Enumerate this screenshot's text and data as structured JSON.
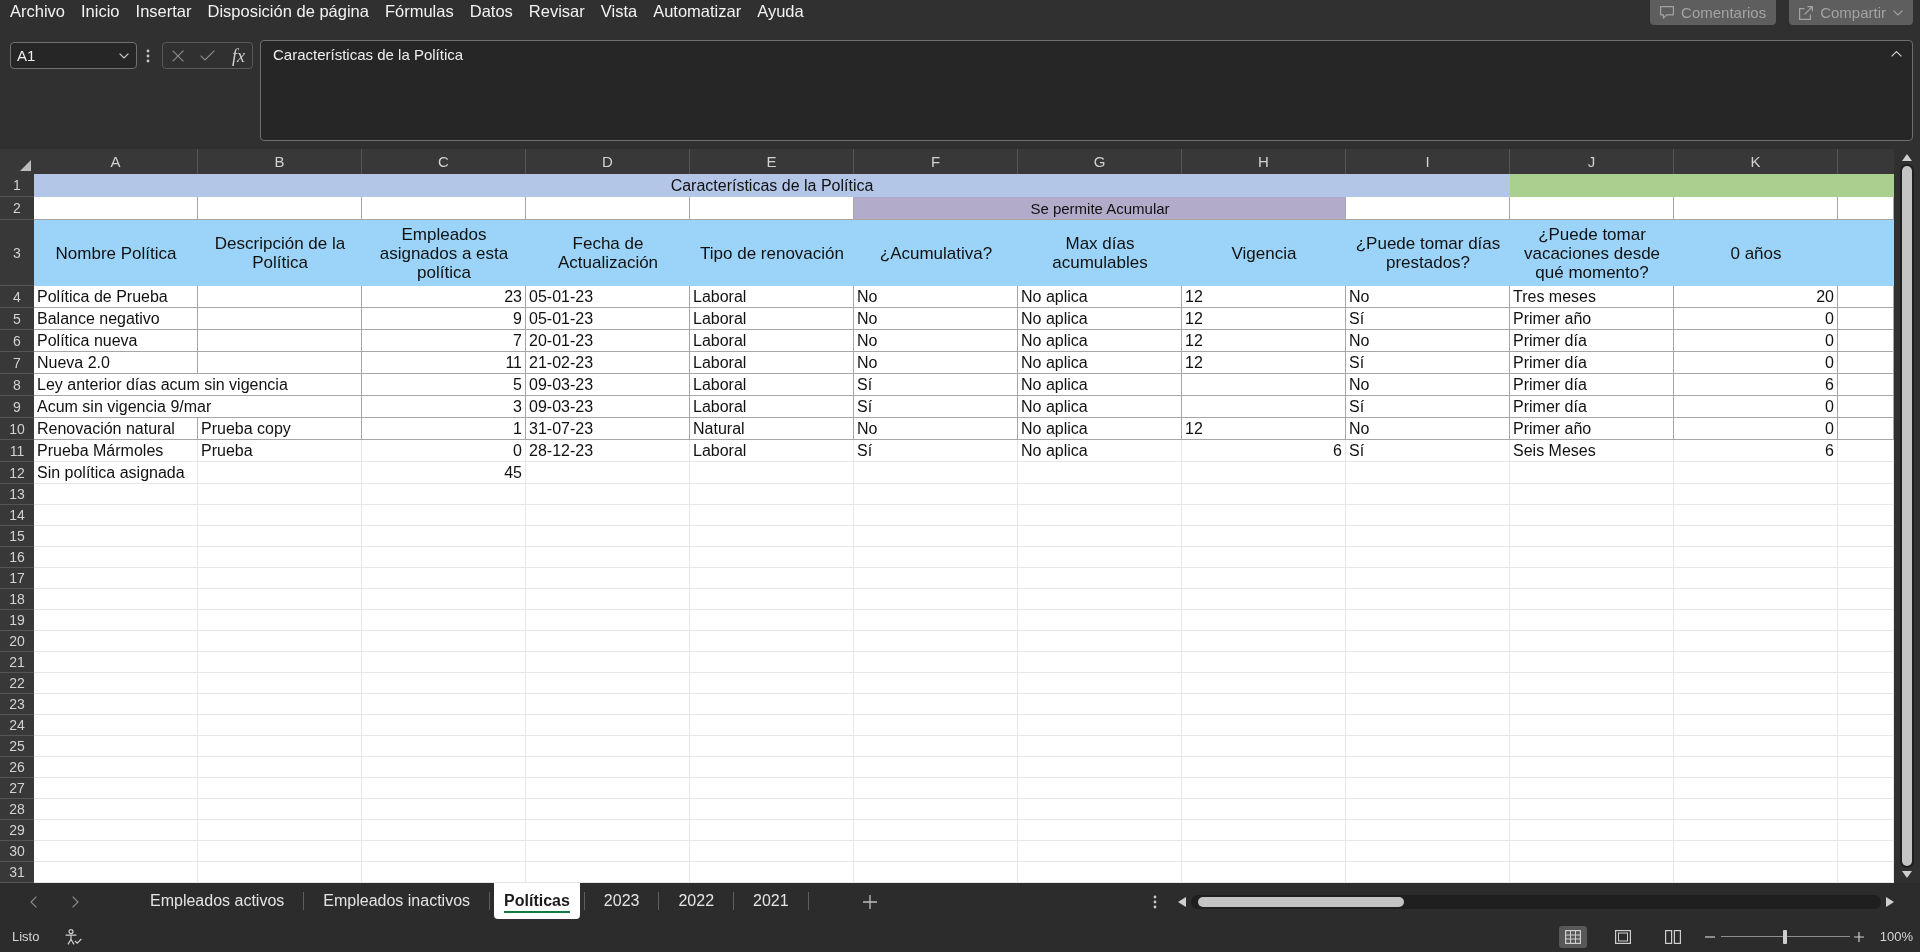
{
  "menu_bar": {
    "items": [
      "Archivo",
      "Inicio",
      "Insertar",
      "Disposición de página",
      "Fórmulas",
      "Datos",
      "Revisar",
      "Vista",
      "Automatizar",
      "Ayuda"
    ],
    "actions": [
      {
        "kind": "comments",
        "label": "Comentarios"
      },
      {
        "kind": "share",
        "label": "Compartir"
      }
    ]
  },
  "formula_bar": {
    "name_box": "A1",
    "function_label": "fx",
    "formula": "Características de la Política"
  },
  "sheet": {
    "columns": [
      "A",
      "B",
      "C",
      "D",
      "E",
      "F",
      "G",
      "H",
      "I",
      "J",
      "K"
    ],
    "row_numbers": [
      "1",
      "2",
      "3",
      "4",
      "5",
      "6",
      "7",
      "8",
      "9",
      "10",
      "11",
      "12",
      "13",
      "14",
      "15",
      "16",
      "17",
      "18",
      "19",
      "20",
      "21",
      "22",
      "23",
      "24",
      "25",
      "26",
      "27",
      "28",
      "29",
      "30",
      "31"
    ],
    "title": "Características de la Política",
    "group_label": "Se permite Acumular",
    "headers": [
      "Nombre Política",
      "Descripción de la Política",
      "Empleados asignados a esta política",
      "Fecha de Actualización",
      "Tipo de renovación",
      "¿Acumulativa?",
      "Max días acumulables",
      "Vigencia",
      "¿Puede tomar días prestados?",
      "¿Puede tomar vacaciones desde qué momento?",
      "0 años"
    ],
    "rows": [
      {
        "kind": "boxed",
        "cells": [
          {
            "text": "Política de Prueba",
            "kind": "text"
          },
          null,
          {
            "text": "23",
            "kind": "number"
          },
          {
            "text": "05-01-23",
            "kind": "text"
          },
          {
            "text": "Laboral",
            "kind": "text"
          },
          {
            "text": "No",
            "kind": "text"
          },
          {
            "text": "No aplica",
            "kind": "text"
          },
          {
            "text": "12",
            "kind": "text"
          },
          {
            "text": "No",
            "kind": "text"
          },
          {
            "text": "Tres meses",
            "kind": "text"
          },
          {
            "text": "20",
            "kind": "number"
          }
        ]
      },
      {
        "kind": "boxed",
        "cells": [
          {
            "text": "Balance negativo",
            "kind": "text"
          },
          null,
          {
            "text": "9",
            "kind": "number"
          },
          {
            "text": "05-01-23",
            "kind": "text"
          },
          {
            "text": "Laboral",
            "kind": "text"
          },
          {
            "text": "No",
            "kind": "text"
          },
          {
            "text": "No aplica",
            "kind": "text"
          },
          {
            "text": "12",
            "kind": "text"
          },
          {
            "text": "Sí",
            "kind": "text"
          },
          {
            "text": "Primer año",
            "kind": "text"
          },
          {
            "text": "0",
            "kind": "number"
          }
        ]
      },
      {
        "kind": "boxed",
        "cells": [
          {
            "text": "Política nueva",
            "kind": "text"
          },
          null,
          {
            "text": "7",
            "kind": "number"
          },
          {
            "text": "20-01-23",
            "kind": "text"
          },
          {
            "text": "Laboral",
            "kind": "text"
          },
          {
            "text": "No",
            "kind": "text"
          },
          {
            "text": "No aplica",
            "kind": "text"
          },
          {
            "text": "12",
            "kind": "text"
          },
          {
            "text": "No",
            "kind": "text"
          },
          {
            "text": "Primer día",
            "kind": "text"
          },
          {
            "text": "0",
            "kind": "number"
          }
        ]
      },
      {
        "kind": "boxed",
        "cells": [
          {
            "text": "Nueva 2.0",
            "kind": "text"
          },
          null,
          {
            "text": "11",
            "kind": "number"
          },
          {
            "text": "21-02-23",
            "kind": "text"
          },
          {
            "text": "Laboral",
            "kind": "text"
          },
          {
            "text": "No",
            "kind": "text"
          },
          {
            "text": "No aplica",
            "kind": "text"
          },
          {
            "text": "12",
            "kind": "text"
          },
          {
            "text": "Sí",
            "kind": "text"
          },
          {
            "text": "Primer día",
            "kind": "text"
          },
          {
            "text": "0",
            "kind": "number"
          }
        ]
      },
      {
        "kind": "boxed",
        "cells": [
          {
            "text": "Ley anterior días acum sin vigencia",
            "kind": "text"
          },
          null,
          {
            "text": "5",
            "kind": "number"
          },
          {
            "text": "09-03-23",
            "kind": "text"
          },
          {
            "text": "Laboral",
            "kind": "text"
          },
          {
            "text": "Sí",
            "kind": "text"
          },
          {
            "text": "No aplica",
            "kind": "text"
          },
          null,
          {
            "text": "No",
            "kind": "text"
          },
          {
            "text": "Primer día",
            "kind": "text"
          },
          {
            "text": "6",
            "kind": "number"
          }
        ]
      },
      {
        "kind": "boxed",
        "cells": [
          {
            "text": "Acum sin vigencia 9/mar",
            "kind": "text"
          },
          null,
          {
            "text": "3",
            "kind": "number"
          },
          {
            "text": "09-03-23",
            "kind": "text"
          },
          {
            "text": "Laboral",
            "kind": "text"
          },
          {
            "text": "Sí",
            "kind": "text"
          },
          {
            "text": "No aplica",
            "kind": "text"
          },
          null,
          {
            "text": "Sí",
            "kind": "text"
          },
          {
            "text": "Primer día",
            "kind": "text"
          },
          {
            "text": "0",
            "kind": "number"
          }
        ]
      },
      {
        "kind": "boxed",
        "cells": [
          {
            "text": "Renovación natural",
            "kind": "text"
          },
          {
            "text": "Prueba copy",
            "kind": "text"
          },
          {
            "text": "1",
            "kind": "number"
          },
          {
            "text": "31-07-23",
            "kind": "text"
          },
          {
            "text": "Natural",
            "kind": "text"
          },
          {
            "text": "No",
            "kind": "text"
          },
          {
            "text": "No aplica",
            "kind": "text"
          },
          {
            "text": "12",
            "kind": "text"
          },
          {
            "text": "No",
            "kind": "text"
          },
          {
            "text": "Primer año",
            "kind": "text"
          },
          {
            "text": "0",
            "kind": "number"
          }
        ]
      },
      {
        "kind": "plain",
        "cells": [
          {
            "text": "Prueba Mármoles",
            "kind": "text"
          },
          {
            "text": "Prueba",
            "kind": "text"
          },
          {
            "text": "0",
            "kind": "number"
          },
          {
            "text": "28-12-23",
            "kind": "text"
          },
          {
            "text": "Laboral",
            "kind": "text"
          },
          {
            "text": "Sí",
            "kind": "text"
          },
          {
            "text": "No aplica",
            "kind": "text"
          },
          {
            "text": "6",
            "kind": "number"
          },
          {
            "text": "Sí",
            "kind": "text"
          },
          {
            "text": "Seis Meses",
            "kind": "text"
          },
          {
            "text": "6",
            "kind": "number"
          }
        ]
      },
      {
        "kind": "plain",
        "cells": [
          {
            "text": "Sin política asignada",
            "kind": "text"
          },
          null,
          {
            "text": "45",
            "kind": "number"
          }
        ]
      }
    ]
  },
  "sheet_tabs": [
    {
      "label": "Empleados activos",
      "selected": false
    },
    {
      "label": "Empleados inactivos",
      "selected": false
    },
    {
      "label": "Políticas",
      "selected": true
    },
    {
      "label": "2023",
      "selected": false
    },
    {
      "label": "2022",
      "selected": false
    },
    {
      "label": "2021",
      "selected": false
    }
  ],
  "status_bar": {
    "status": "Listo",
    "views": [
      {
        "kind": "normal",
        "selected": true
      },
      {
        "kind": "page_layout",
        "selected": false
      },
      {
        "kind": "page_break",
        "selected": false
      }
    ],
    "zoom": {
      "level": 0.5,
      "label": "100%"
    }
  }
}
